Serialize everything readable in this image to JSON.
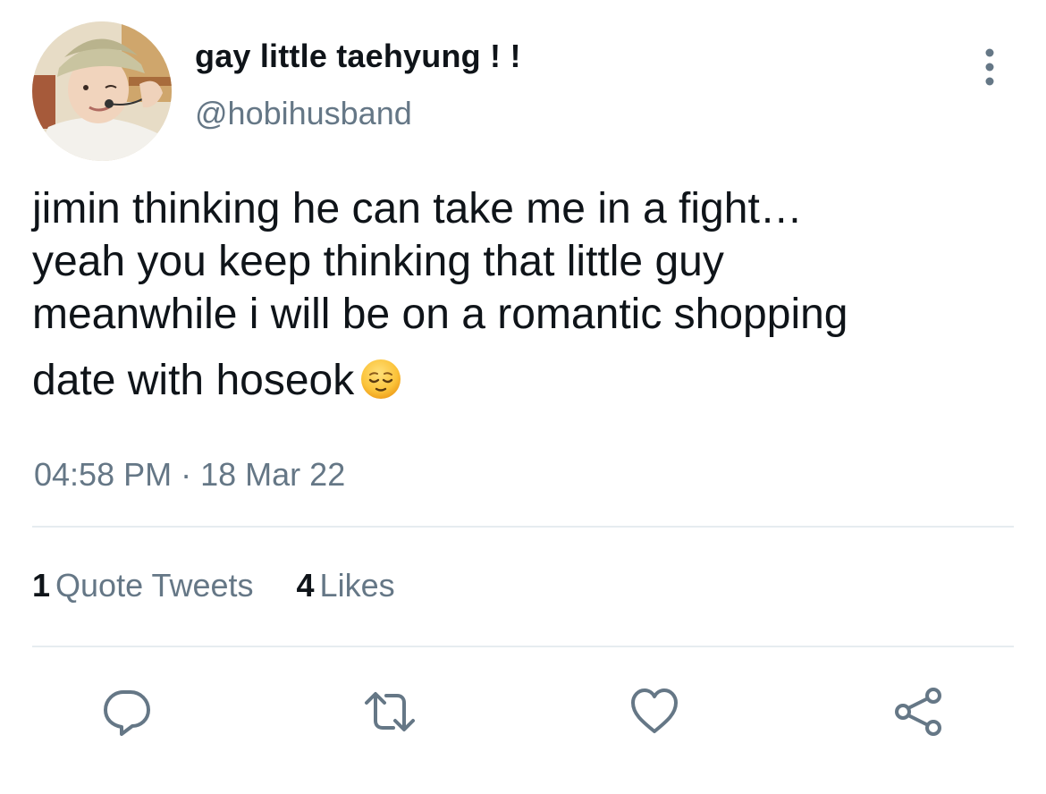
{
  "user": {
    "display_name": "gay little taehyung ! !",
    "handle": "@hobihusband"
  },
  "tweet": {
    "lines": [
      "jimin thinking he can take me in a fight…",
      "yeah you keep thinking that little guy",
      "meanwhile i will be on a romantic shopping",
      "date with hoseok"
    ],
    "emoji": "relieved-face",
    "time": "04:58 PM",
    "separator": "·",
    "date": "18 Mar 22"
  },
  "stats": {
    "quote_count": "1",
    "quote_label": "Quote Tweets",
    "like_count": "4",
    "like_label": "Likes"
  },
  "colors": {
    "text": "#0f1419",
    "secondary": "#657786",
    "divider": "#e6ecf0",
    "icon": "#657786"
  },
  "icons": {
    "more": "more-vertical-icon",
    "reply": "reply-icon",
    "retweet": "retweet-icon",
    "like": "heart-icon",
    "share": "share-icon"
  }
}
